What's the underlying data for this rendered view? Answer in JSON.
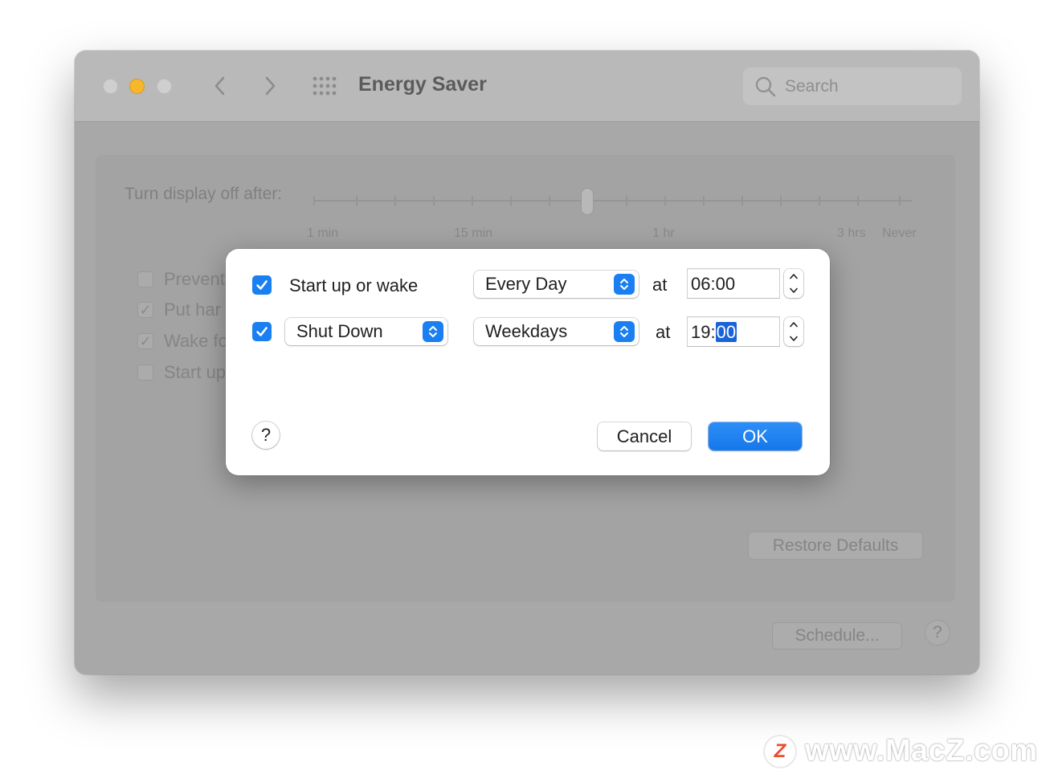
{
  "window": {
    "title": "Energy Saver",
    "search_placeholder": "Search"
  },
  "background": {
    "slider_label": "Turn display off after:",
    "slider_ticks": [
      "1 min",
      "15 min",
      "1 hr",
      "3 hrs",
      "Never"
    ],
    "options": [
      {
        "label": "Prevent",
        "checked": false
      },
      {
        "label": "Put har",
        "checked": true
      },
      {
        "label": "Wake fo",
        "checked": true
      },
      {
        "label": "Start up",
        "checked": false
      }
    ],
    "restore_label": "Restore Defaults",
    "schedule_label": "Schedule...",
    "help_label": "?"
  },
  "dialog": {
    "row1": {
      "checked": true,
      "label": "Start up or wake",
      "day": "Every Day",
      "at": "at",
      "time": "06:00"
    },
    "row2": {
      "checked": true,
      "action": "Shut Down",
      "day": "Weekdays",
      "at": "at",
      "time_hours": "19",
      "time_sep": ":",
      "time_minutes": "00"
    },
    "help_label": "?",
    "cancel_label": "Cancel",
    "ok_label": "OK"
  },
  "watermark": {
    "logo": "Z",
    "text": "www.MacZ.com"
  },
  "colors": {
    "accent": "#1a7ff0",
    "minimize": "#f6b72d"
  }
}
